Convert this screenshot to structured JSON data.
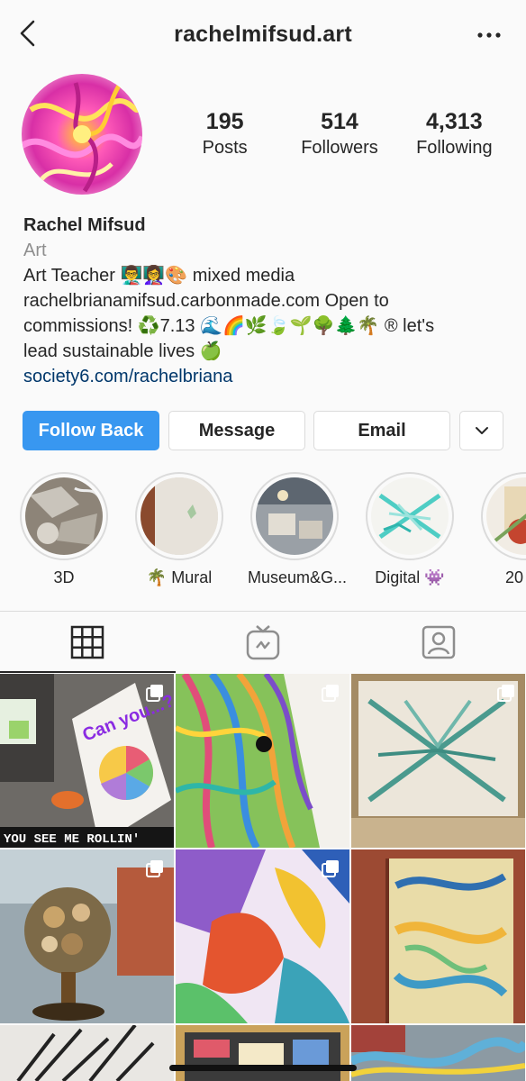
{
  "header": {
    "username": "rachelmifsud.art",
    "back_icon": "chevron-left-icon",
    "more_icon": "ellipsis-icon"
  },
  "profile": {
    "stats": [
      {
        "value": "195",
        "label": "Posts"
      },
      {
        "value": "514",
        "label": "Followers"
      },
      {
        "value": "4,313",
        "label": "Following"
      }
    ],
    "name": "Rachel Mifsud",
    "category": "Art",
    "bio_lines": [
      "Art Teacher 👨‍🏫👩‍🏫🎨 mixed media",
      "rachelbrianamifsud.carbonmade.com Open to",
      "commissions! ♻️7.13 🌊🌈🌿🍃🌱🌳🌲🌴 ® let's",
      "lead sustainable lives 🍏"
    ],
    "link": "society6.com/rachelbriana"
  },
  "actions": {
    "follow_back": "Follow Back",
    "message": "Message",
    "email": "Email",
    "dropdown_icon": "chevron-down-icon"
  },
  "highlights": [
    {
      "label": "3D"
    },
    {
      "label": "🌴 Mural"
    },
    {
      "label": "Museum&G..."
    },
    {
      "label": "Digital 👾"
    },
    {
      "label": "20"
    }
  ],
  "tabs": [
    {
      "icon": "grid-icon"
    },
    {
      "icon": "igtv-icon"
    },
    {
      "icon": "tagged-icon"
    }
  ],
  "grid_posts": [
    {
      "caption": "Can you...?",
      "overlay": "YOU SEE ME ROLLIN'",
      "multi": true
    },
    {
      "caption": "",
      "overlay": "",
      "multi": true
    },
    {
      "caption": "",
      "overlay": "",
      "multi": true
    },
    {
      "caption": "",
      "overlay": "",
      "multi": true
    },
    {
      "caption": "",
      "overlay": "",
      "multi": true
    },
    {
      "caption": "",
      "overlay": "",
      "multi": false
    },
    {
      "caption": "",
      "overlay": "",
      "multi": false
    },
    {
      "caption": "",
      "overlay": "",
      "multi": false
    },
    {
      "caption": "",
      "overlay": "",
      "multi": false
    }
  ],
  "colors": {
    "primary": "#3897f0",
    "link": "#00376b",
    "muted": "#8e8e8e",
    "border": "#dbdbdb"
  }
}
